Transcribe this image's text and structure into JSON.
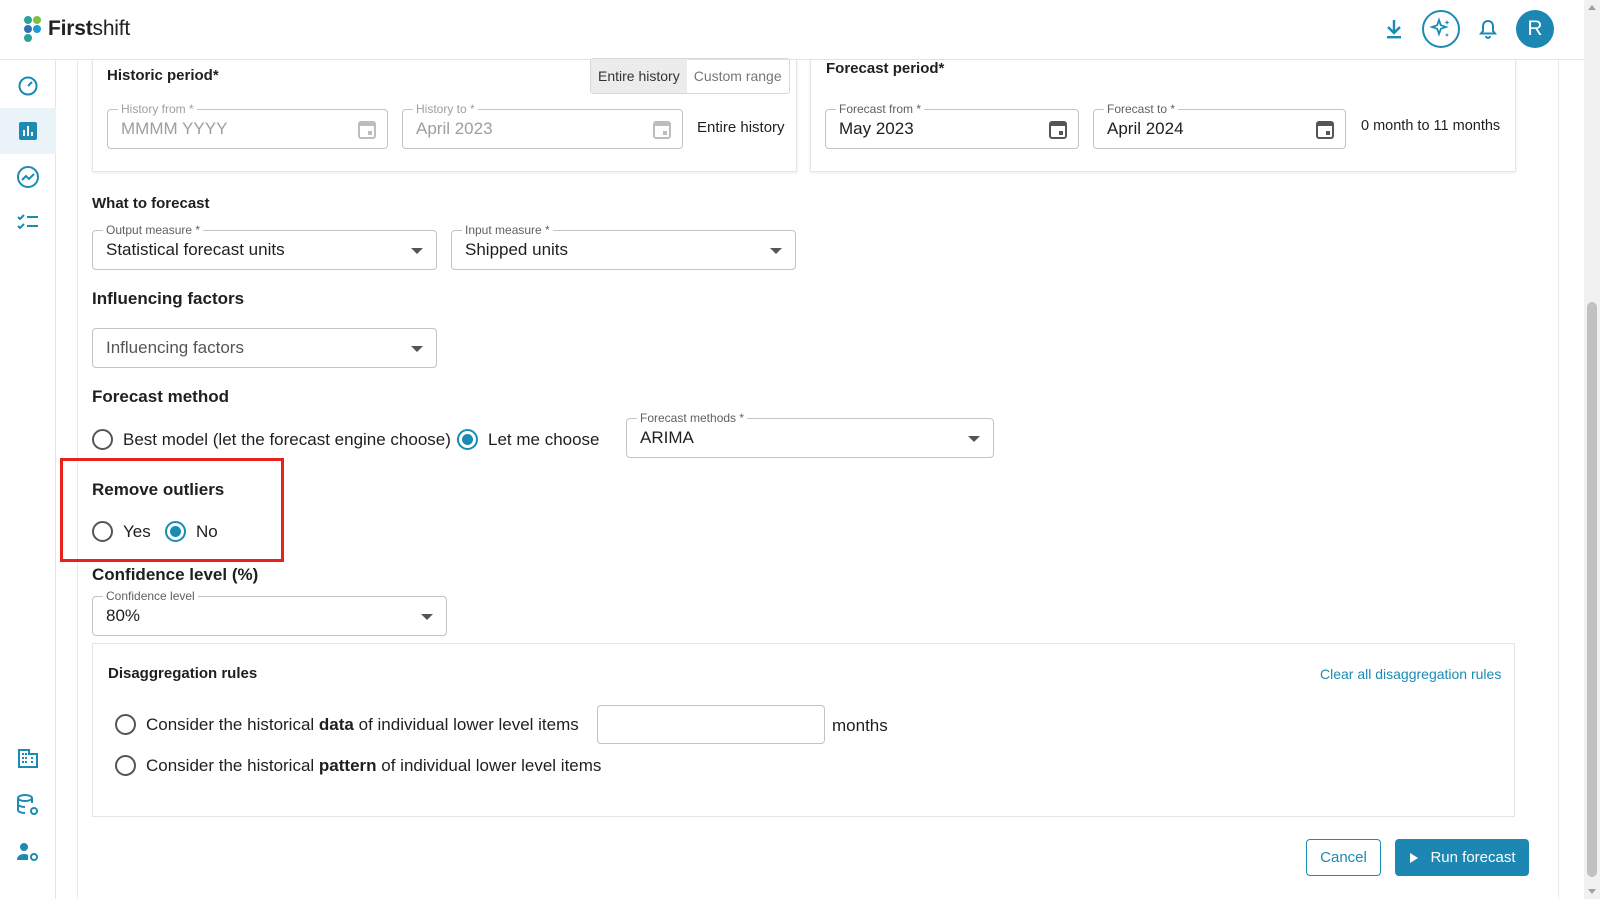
{
  "app": {
    "brand_bold": "First",
    "brand_rest": "shift",
    "avatar_initial": "R"
  },
  "icons": {
    "download": "download-icon",
    "ai": "sparkle-icon",
    "notifications": "bell-icon",
    "nav": [
      "dashboard-gauge-icon",
      "bar-chart-icon",
      "trend-chart-icon",
      "checklist-icon",
      "building-icon",
      "database-settings-icon",
      "user-settings-icon"
    ]
  },
  "colors": {
    "accent": "#1b8bb4",
    "highlight": "#e8211b",
    "active_nav_bg": "#e9f3f8"
  },
  "historic": {
    "title": "Historic period*",
    "toggle": [
      "Entire history",
      "Custom range"
    ],
    "toggle_selected": "Entire history",
    "history_from_label": "History from *",
    "history_from_placeholder": "MMMM YYYY",
    "history_to_label": "History to *",
    "history_to_value": "April 2023",
    "summary": "Entire history"
  },
  "forecast_period": {
    "title": "Forecast period*",
    "from_label": "Forecast from *",
    "from_value": "May 2023",
    "to_label": "Forecast to *",
    "to_value": "April 2024",
    "summary": "0 month to 11 months"
  },
  "what_to_forecast": {
    "title": "What to forecast",
    "output_label": "Output measure *",
    "output_value": "Statistical forecast units",
    "input_label": "Input measure *",
    "input_value": "Shipped units"
  },
  "influencing": {
    "title": "Influencing factors",
    "placeholder": "Influencing factors"
  },
  "method": {
    "title": "Forecast method",
    "option_best": "Best model (let the forecast engine choose)",
    "option_choose": "Let me choose",
    "selected": "Let me choose",
    "methods_label": "Forecast methods *",
    "methods_value": "ARIMA"
  },
  "outliers": {
    "title": "Remove outliers",
    "yes": "Yes",
    "no": "No",
    "selected": "No"
  },
  "confidence": {
    "title": "Confidence level (%)",
    "label": "Confidence level",
    "value": "80%"
  },
  "disaggregation": {
    "title": "Disaggregation rules",
    "clear_link": "Clear all disaggregation rules",
    "opt1_pre": "Consider the historical ",
    "opt1_bold": "data",
    "opt1_post": " of individual lower level items",
    "opt1_unit": "months",
    "opt1_input_value": "",
    "opt2_pre": "Consider the historical ",
    "opt2_bold": "pattern",
    "opt2_post": " of individual lower level items"
  },
  "actions": {
    "cancel": "Cancel",
    "run": "Run forecast"
  }
}
